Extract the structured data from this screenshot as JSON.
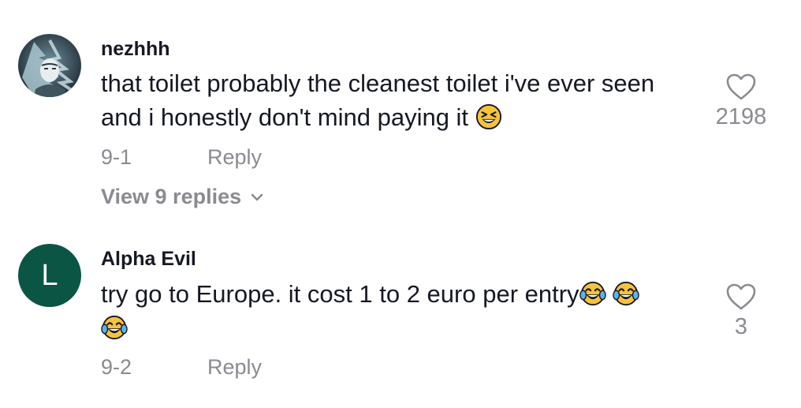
{
  "comments": [
    {
      "username": "nezhhh",
      "avatar_icon": "anime-character-avatar",
      "text": "that toilet probably the cleanest toilet i've ever seen and i honestly don't mind paying it",
      "emojis": [
        "grinning-squinting-face-emoji"
      ],
      "date": "9-1",
      "reply_label": "Reply",
      "view_replies_label": "View 9 replies",
      "like_icon": "heart-outline-icon",
      "likes": "2198"
    },
    {
      "username": "Alpha Evil",
      "avatar_letter": "L",
      "avatar_color": "#0b5545",
      "text": "try go to Europe. it cost 1 to 2 euro per entry",
      "emojis": [
        "face-with-tears-of-joy-emoji",
        "face-with-tears-of-joy-emoji",
        "face-with-tears-of-joy-emoji"
      ],
      "date": "9-2",
      "reply_label": "Reply",
      "like_icon": "heart-outline-icon",
      "likes": "3"
    }
  ],
  "colors": {
    "text_primary": "#161823",
    "text_secondary": "#8a8b91",
    "background": "#ffffff"
  }
}
